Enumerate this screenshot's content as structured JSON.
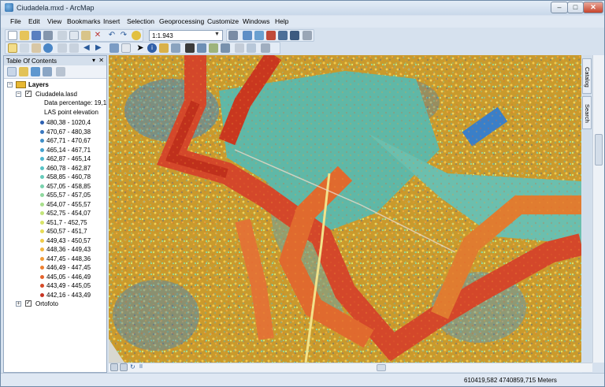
{
  "window": {
    "title": "Ciudadela.mxd - ArcMap"
  },
  "menu": [
    "File",
    "Edit",
    "View",
    "Bookmarks",
    "Insert",
    "Selection",
    "Geoprocessing",
    "Customize",
    "Windows",
    "Help"
  ],
  "toolbar": {
    "scale_value": "1:1.943"
  },
  "toc": {
    "title": "Table Of Contents",
    "root_label": "Layers",
    "layer1": {
      "name": "Ciudadela.lasd",
      "data_percentage": "Data percentage: 19,1",
      "renderer_label": "LAS point elevation",
      "classes": [
        {
          "label": "480,38 - 1020,4",
          "color": "#2d5fb0"
        },
        {
          "label": "470,67 - 480,38",
          "color": "#3a78c0"
        },
        {
          "label": "467,71 - 470,67",
          "color": "#3f8fc8"
        },
        {
          "label": "465,14 - 467,71",
          "color": "#45a3cf"
        },
        {
          "label": "462,87 - 465,14",
          "color": "#4cb6cf"
        },
        {
          "label": "460,78 - 462,87",
          "color": "#56c3c6"
        },
        {
          "label": "458,85 - 460,78",
          "color": "#66ccbb"
        },
        {
          "label": "457,05 - 458,85",
          "color": "#79d3ae"
        },
        {
          "label": "455,57 - 457,05",
          "color": "#8fd99f"
        },
        {
          "label": "454,07 - 455,57",
          "color": "#a8df8c"
        },
        {
          "label": "452,75 - 454,07",
          "color": "#c2e47a"
        },
        {
          "label": "451,7 - 452,75",
          "color": "#d8e468"
        },
        {
          "label": "450,57 - 451,7",
          "color": "#e8dc55"
        },
        {
          "label": "449,43 - 450,57",
          "color": "#f0cc48"
        },
        {
          "label": "448,36 - 449,43",
          "color": "#f2b63e"
        },
        {
          "label": "447,45 - 448,36",
          "color": "#f29b36"
        },
        {
          "label": "446,49 - 447,45",
          "color": "#ee7f2f"
        },
        {
          "label": "445,05 - 446,49",
          "color": "#e4622b"
        },
        {
          "label": "443,49 - 445,05",
          "color": "#d64a27"
        },
        {
          "label": "442,16 - 443,49",
          "color": "#c73423"
        }
      ]
    },
    "layer2": {
      "name": "Ortofoto"
    }
  },
  "side_tabs": [
    "Catalog",
    "Search"
  ],
  "status": {
    "coordinates": "610419,582  4740859,715 Meters"
  }
}
